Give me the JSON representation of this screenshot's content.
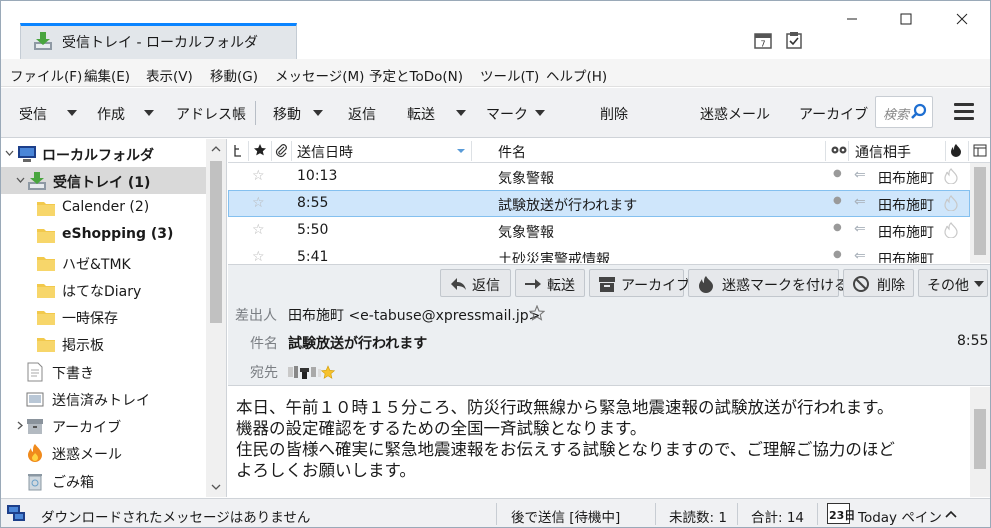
{
  "window": {
    "tab_title": "受信トレイ - ローカルフォルダ"
  },
  "menu": [
    "ファイル(F)",
    "編集(E)",
    "表示(V)",
    "移動(G)",
    "メッセージ(M)",
    "予定とToDo(N)",
    "ツール(T)",
    "ヘルプ(H)"
  ],
  "toolbar": {
    "get": "受信",
    "write": "作成",
    "address_book": "アドレス帳",
    "move": "移動",
    "reply": "返信",
    "forward": "転送",
    "mark": "マーク",
    "delete": "削除",
    "junk": "迷惑メール",
    "archive": "アーカイブ",
    "search_placeholder": "検索"
  },
  "folders": [
    {
      "label": "ローカルフォルダ",
      "icon": "computer-icon"
    },
    {
      "label": "受信トレイ (1)",
      "icon": "inbox-icon"
    },
    {
      "label": "Calender (2)",
      "icon": "folder-icon"
    },
    {
      "label": "eShopping (3)",
      "icon": "folder-icon"
    },
    {
      "label": "ハゼ&TMK",
      "icon": "folder-icon"
    },
    {
      "label": "はてなDiary",
      "icon": "folder-icon"
    },
    {
      "label": "一時保存",
      "icon": "folder-icon"
    },
    {
      "label": "掲示板",
      "icon": "folder-icon"
    },
    {
      "label": "下書き",
      "icon": "drafts-icon"
    },
    {
      "label": "送信済みトレイ",
      "icon": "sent-icon"
    },
    {
      "label": "アーカイブ",
      "icon": "archive-icon"
    },
    {
      "label": "迷惑メール",
      "icon": "junk-icon"
    },
    {
      "label": "ごみ箱",
      "icon": "trash-icon"
    }
  ],
  "thread_columns": {
    "date": "送信日時",
    "subject": "件名",
    "correspondent": "通信相手"
  },
  "messages": [
    {
      "date": "10:13",
      "subject": "気象警報",
      "from": "田布施町"
    },
    {
      "date": "8:55",
      "subject": "試験放送が行われます",
      "from": "田布施町"
    },
    {
      "date": "5:50",
      "subject": "気象警報",
      "from": "田布施町"
    },
    {
      "date": "5:41",
      "subject": "土砂災害警戒情報",
      "from": "田布施町"
    }
  ],
  "msg_buttons": {
    "reply": "返信",
    "forward": "転送",
    "archive": "アーカイブ",
    "junk": "迷惑マークを付ける",
    "delete": "削除",
    "other": "その他"
  },
  "header": {
    "from_label": "差出人",
    "from_value": "田布施町 <e-tabuse@xpressmail.jp>",
    "subject_label": "件名",
    "subject_value": "試験放送が行われます",
    "time": "8:55",
    "to_label": "宛先"
  },
  "body_lines": [
    "本日、午前１０時１５分ころ、防災行政無線から緊急地震速報の試験放送が行われます。",
    "機器の設定確認をするための全国一斉試験となります。",
    "住民の皆様へ確実に緊急地震速報をお伝えする試験となりますので、ご理解ご協力のほど",
    "よろしくお願いします。"
  ],
  "status": {
    "download": "ダウンロードされたメッセージはありません",
    "send_later": "後で送信 [待機中]",
    "unread": "未読数: 1",
    "total": "合計: 14",
    "calendar_day": "23日",
    "today_pane": "Today ペイン"
  }
}
